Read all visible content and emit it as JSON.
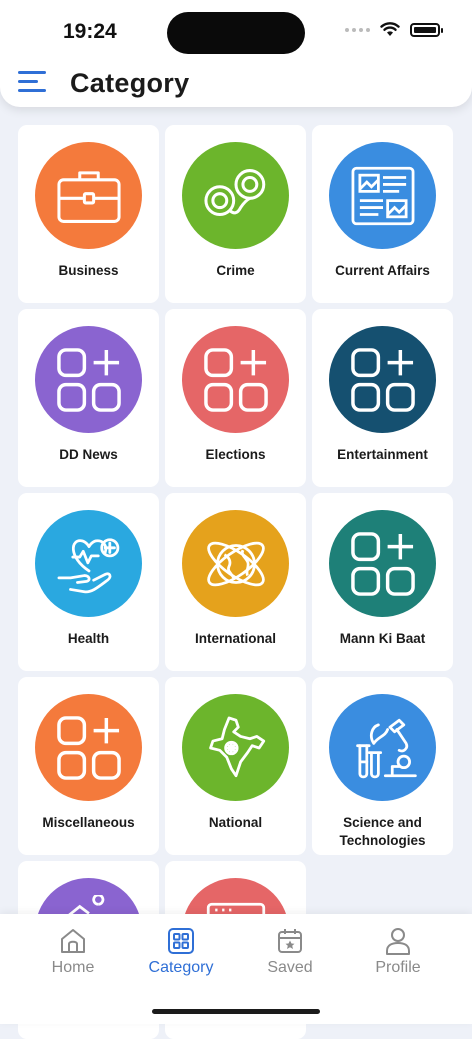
{
  "status_bar": {
    "time": "19:24"
  },
  "header": {
    "title": "Category",
    "menu_icon": "hamburger-menu-icon"
  },
  "colors": {
    "accent": "#2f6fd6",
    "inactive": "#8a8a8a"
  },
  "categories": [
    {
      "label": "Business",
      "color": "#f47a3c",
      "icon": "briefcase-icon"
    },
    {
      "label": "Crime",
      "color": "#6cb52c",
      "icon": "handcuffs-icon"
    },
    {
      "label": "Current Affairs",
      "color": "#3a8de0",
      "icon": "newspaper-icon"
    },
    {
      "label": "DD News",
      "color": "#8a64d0",
      "icon": "category-grid-plus-icon"
    },
    {
      "label": "Elections",
      "color": "#e56667",
      "icon": "category-grid-plus-icon"
    },
    {
      "label": "Entertainment",
      "color": "#155070",
      "icon": "category-grid-plus-icon"
    },
    {
      "label": "Health",
      "color": "#2aa8e0",
      "icon": "heart-in-hand-icon"
    },
    {
      "label": "International",
      "color": "#e5a21c",
      "icon": "globe-orbit-icon"
    },
    {
      "label": "Mann Ki Baat",
      "color": "#1e8078",
      "icon": "category-grid-plus-icon"
    },
    {
      "label": "Miscellaneous",
      "color": "#f47a3c",
      "icon": "category-grid-plus-icon"
    },
    {
      "label": "National",
      "color": "#6cb52c",
      "icon": "india-map-icon"
    },
    {
      "label": "Science and Technologies",
      "color": "#3a8de0",
      "icon": "microscope-icon"
    },
    {
      "label": "",
      "color": "#8a64d0",
      "icon": "partial-icon"
    },
    {
      "label": "",
      "color": "#e56667",
      "icon": "browser-window-icon"
    }
  ],
  "bottom_nav": [
    {
      "label": "Home",
      "icon": "home-icon",
      "active": false
    },
    {
      "label": "Category",
      "icon": "category-icon",
      "active": true
    },
    {
      "label": "Saved",
      "icon": "saved-calendar-star-icon",
      "active": false
    },
    {
      "label": "Profile",
      "icon": "profile-icon",
      "active": false
    }
  ]
}
